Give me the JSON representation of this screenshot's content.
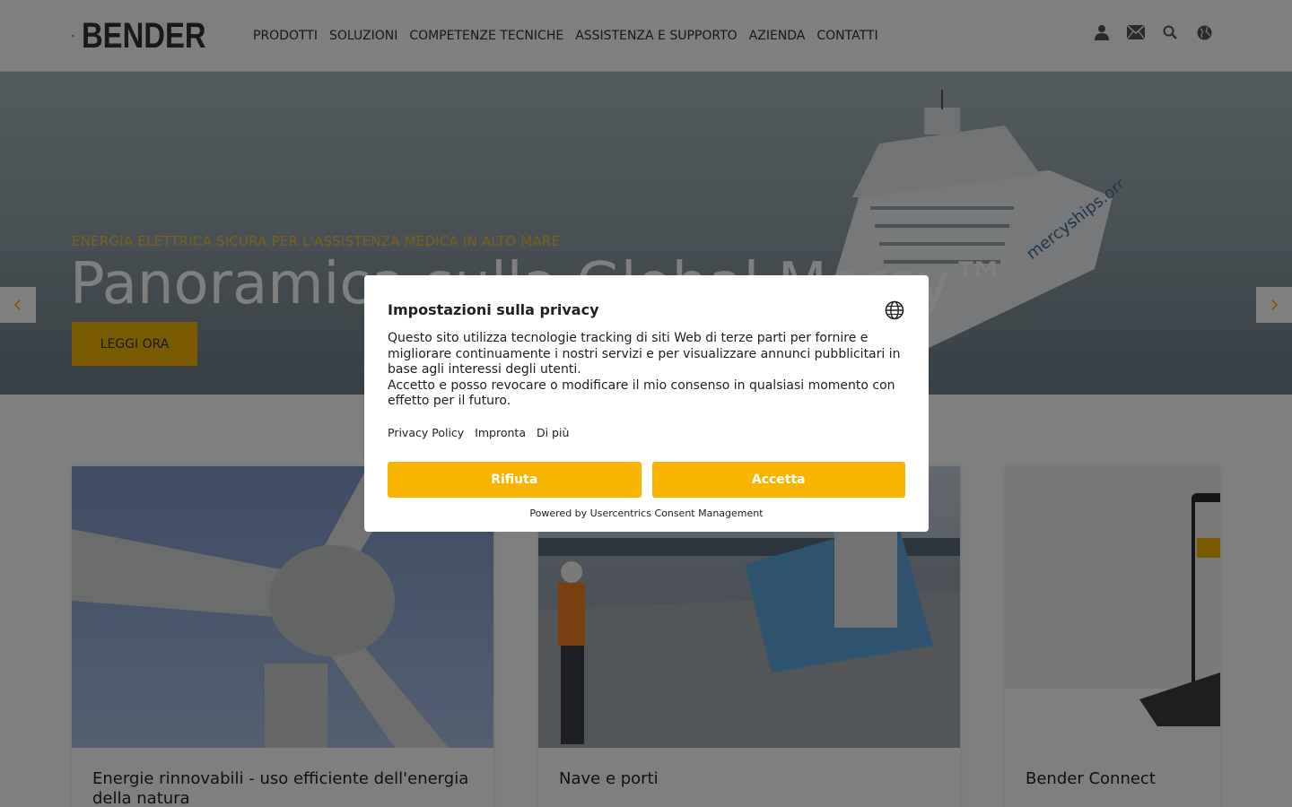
{
  "header": {
    "logo_text": "BENDER",
    "nav": [
      "PRODOTTI",
      "SOLUZIONI",
      "COMPETENZE TECNICHE",
      "ASSISTENZA E SUPPORTO",
      "AZIENDA",
      "CONTATTI"
    ],
    "icons": [
      "user-icon",
      "mail-icon",
      "search-icon",
      "globe-icon"
    ]
  },
  "hero": {
    "eyebrow": "ENERGIA ELETTRICA SICURA PER L'ASSISTENZA MEDICA IN ALTO MARE",
    "title": "Panoramica sulla Global Mercy™",
    "button": "LEGGI ORA",
    "ship_text": "mercyships.org"
  },
  "cards": [
    {
      "title": "Energie rinnovabili - uso efficiente dell'energia della natura"
    },
    {
      "title": "Nave e porti"
    },
    {
      "title": "Bender Connect"
    }
  ],
  "consent": {
    "title": "Impostazioni sulla privacy",
    "text": "Questo sito utilizza tecnologie tracking di siti Web di terze parti per fornire e migliorare continuamente i nostri servizi e per visualizzare annunci pubblicitari in base agli interessi degli utenti.",
    "text2": "Accetto e posso revocare o modificare il mio consenso in qualsiasi momento con effetto per il futuro.",
    "links": [
      "Privacy Policy",
      "Impronta",
      "Di più"
    ],
    "reject": "Rifiuta",
    "accept": "Accetta",
    "powered": "Powered by Usercentrics Consent Management"
  },
  "colors": {
    "accent": "#f7b500",
    "text": "#333333"
  }
}
